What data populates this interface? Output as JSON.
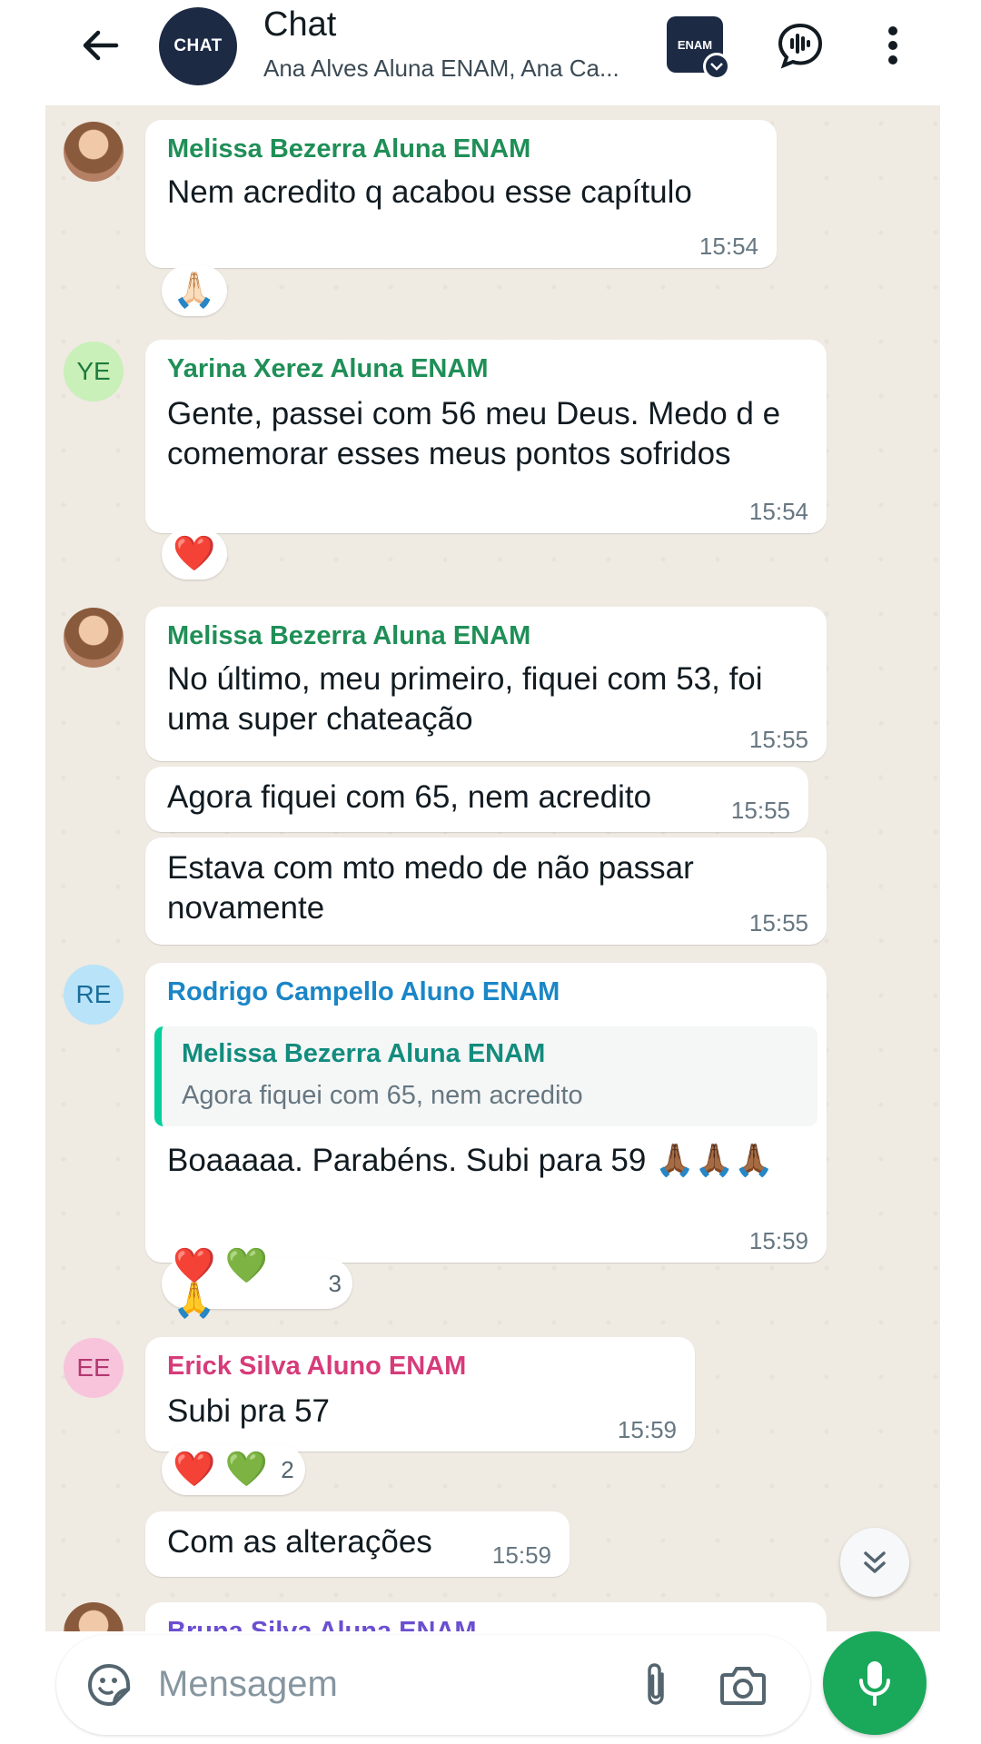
{
  "header": {
    "back_icon": "arrow-back-icon",
    "group_avatar_text": "CHAT",
    "title": "Chat",
    "subtitle": "Ana Alves Aluna ENAM, Ana Ca...",
    "community_label": "ENAM",
    "icons": [
      "voice-chat-icon",
      "more-vert-icon"
    ]
  },
  "colors": {
    "chat_background": "#efeae2",
    "green_sender": "#1f8f57",
    "blue_sender": "#1a86c7",
    "pink_sender": "#d63b7a",
    "violet_sender": "#6b4fcf",
    "mic_button": "#1aa85b"
  },
  "messages": {
    "m1": {
      "sender": "Melissa Bezerra Aluna ENAM",
      "text": "Nem acredito q acabou esse capítulo",
      "time": "15:54",
      "reactions": "🙏🏻"
    },
    "m2": {
      "avatar": "YE",
      "sender": "Yarina Xerez Aluna ENAM",
      "text": "Gente, passei com 56 meu Deus. Medo d e comemorar esses meus pontos sofridos",
      "time": "15:54",
      "reactions": "❤️"
    },
    "m3": {
      "sender": "Melissa Bezerra Aluna ENAM",
      "text": "No último, meu primeiro, fiquei com 53, foi uma super chateação",
      "time": "15:55"
    },
    "m4": {
      "text": "Agora fiquei com 65, nem acredito",
      "time": "15:55"
    },
    "m5": {
      "text": "Estava com mto medo de não passar novamente",
      "time": "15:55"
    },
    "m6": {
      "avatar": "RE",
      "sender": "Rodrigo Campello Aluno ENAM",
      "quote_sender": "Melissa Bezerra Aluna ENAM",
      "quote_text": "Agora fiquei com 65, nem acredito",
      "text": "Boaaaaa. Parabéns. Subi para 59 🙏🏾🙏🏾🙏🏾",
      "time": "15:59",
      "reactions": {
        "emojis": "❤️ 💚 🙏",
        "count": "3"
      }
    },
    "m7": {
      "avatar": "EE",
      "sender": "Erick Silva Aluno ENAM",
      "text": "Subi pra 57",
      "time": "15:59",
      "reactions": {
        "emojis": "❤️ 💚",
        "count": "2"
      }
    },
    "m8": {
      "text": "Com as alterações",
      "time": "15:59"
    },
    "m9": {
      "sender": "Bruna Silva Aluna ENAM"
    }
  },
  "composer": {
    "placeholder": "Mensagem",
    "icons": [
      "sticker-icon",
      "attach-icon",
      "camera-icon",
      "mic-icon"
    ]
  }
}
